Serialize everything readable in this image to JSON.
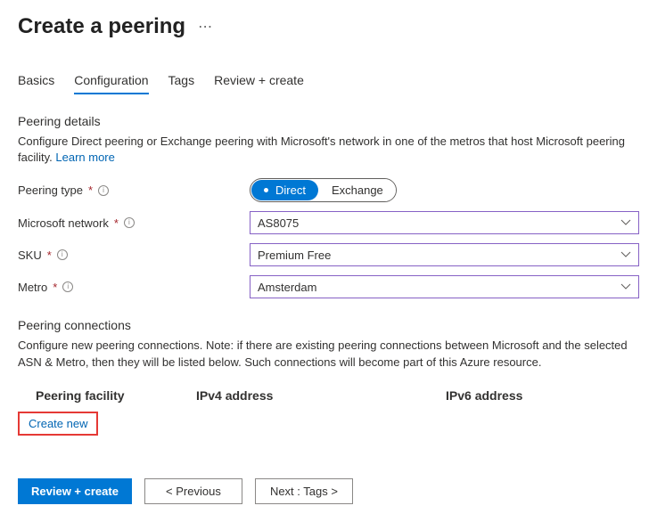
{
  "title": "Create a peering",
  "ellipsis": "⋯",
  "tabs": {
    "basics": "Basics",
    "configuration": "Configuration",
    "tags": "Tags",
    "review": "Review + create",
    "activeIndex": 1
  },
  "details": {
    "heading": "Peering details",
    "desc_pre": "Configure Direct peering or Exchange peering with Microsoft's network in one of the metros that host Microsoft peering facility. ",
    "learn_more": "Learn more"
  },
  "fields": {
    "peering_type": {
      "label": "Peering type",
      "opt_direct": "Direct",
      "opt_exchange": "Exchange",
      "selected": "Direct"
    },
    "ms_network": {
      "label": "Microsoft network",
      "value": "AS8075"
    },
    "sku": {
      "label": "SKU",
      "value": "Premium Free"
    },
    "metro": {
      "label": "Metro",
      "value": "Amsterdam"
    }
  },
  "connections": {
    "heading": "Peering connections",
    "desc": "Configure new peering connections. Note: if there are existing peering connections between Microsoft and the selected ASN & Metro, then they will be listed below. Such connections will become part of this Azure resource.",
    "col_facility": "Peering facility",
    "col_ipv4": "IPv4 address",
    "col_ipv6": "IPv6 address",
    "create_new": "Create new"
  },
  "footer": {
    "review": "Review + create",
    "previous": "< Previous",
    "next": "Next : Tags >"
  }
}
